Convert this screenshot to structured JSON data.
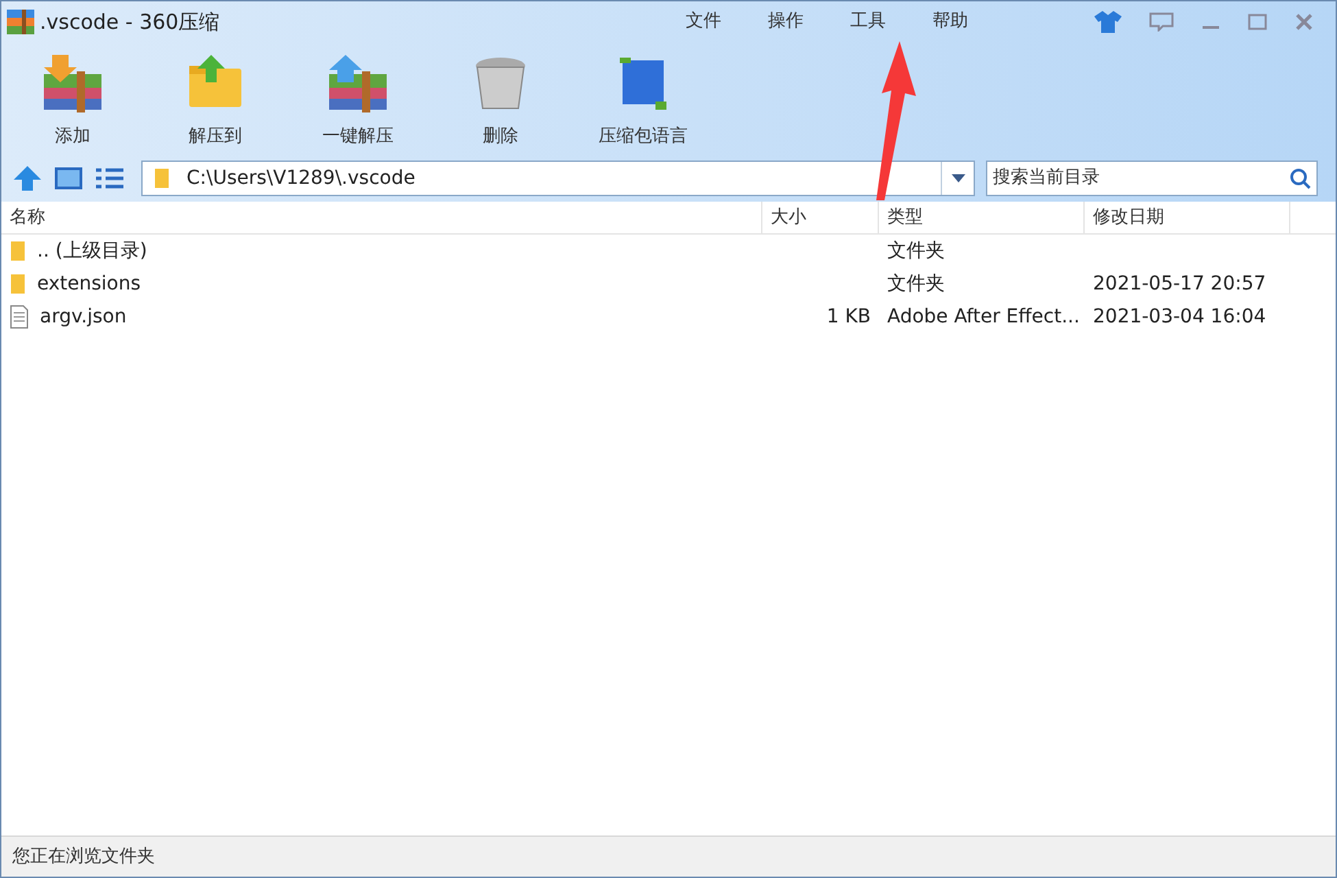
{
  "window": {
    "title": ".vscode - 360压缩"
  },
  "menu": [
    "文件",
    "操作",
    "工具",
    "帮助"
  ],
  "toolbar": [
    {
      "label": "添加",
      "kind": "add"
    },
    {
      "label": "解压到",
      "kind": "extract"
    },
    {
      "label": "一键解压",
      "kind": "oneclick"
    },
    {
      "label": "删除",
      "kind": "delete"
    },
    {
      "label": "压缩包语言",
      "kind": "language"
    }
  ],
  "address": {
    "value": "C:\\Users\\V1289\\.vscode"
  },
  "search": {
    "placeholder": "搜索当前目录"
  },
  "table": {
    "columns": [
      "名称",
      "大小",
      "类型",
      "修改日期"
    ],
    "rows": [
      {
        "name": ".. (上级目录)",
        "size": "",
        "type": "文件夹",
        "date": "",
        "kind": "folder"
      },
      {
        "name": "extensions",
        "size": "",
        "type": "文件夹",
        "date": "2021-05-17 20:57",
        "kind": "folder"
      },
      {
        "name": "argv.json",
        "size": "1 KB",
        "type": "Adobe After Effect...",
        "date": "2021-03-04 16:04",
        "kind": "file"
      }
    ]
  },
  "status_bar": "您正在浏览文件夹"
}
